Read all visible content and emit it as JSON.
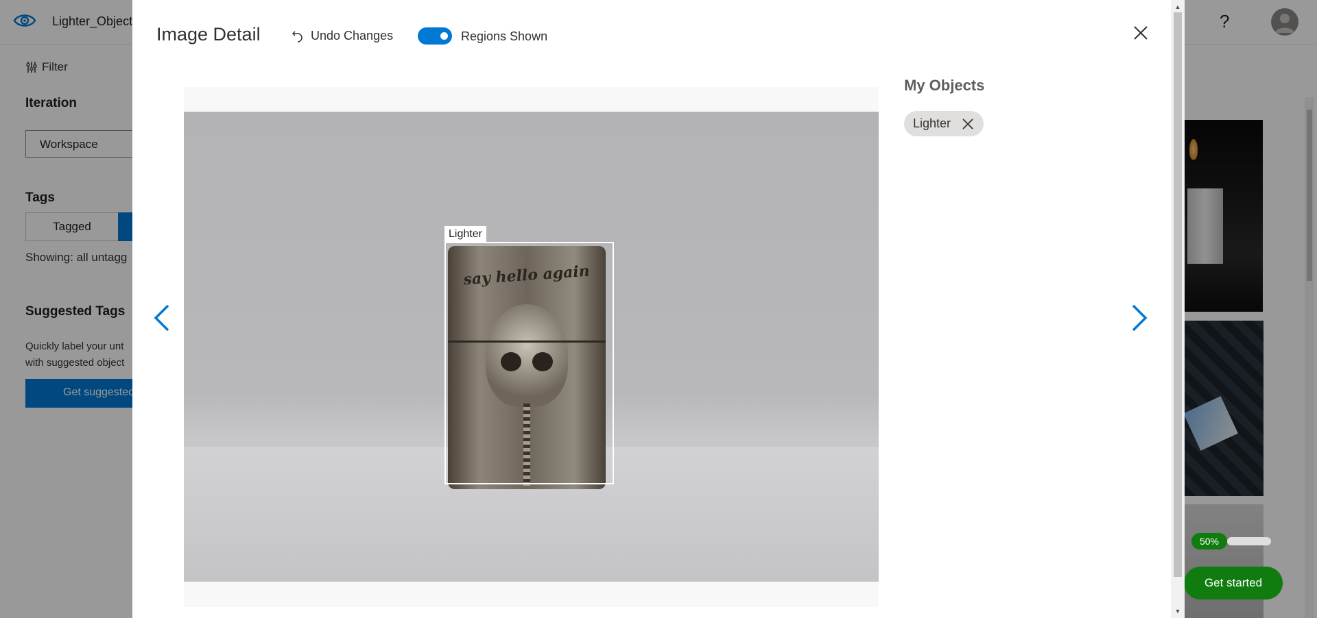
{
  "app": {
    "project_name": "Lighter_Object",
    "settings_icon": "gear-icon",
    "help_label": "?",
    "logo_icon": "eye-icon"
  },
  "sidebar": {
    "filter_label": "Filter",
    "iteration_heading": "Iteration",
    "iteration_value": "Workspace",
    "tags_heading": "Tags",
    "tagged_label": "Tagged",
    "showing_text": "Showing: all untagg",
    "suggested_heading": "Suggested Tags",
    "suggested_desc_line1": "Quickly label your unt",
    "suggested_desc_line2": "with suggested object",
    "get_suggested_label": "Get suggested"
  },
  "onboarding": {
    "progress_label": "50%",
    "progress_value": 0.5,
    "get_started_label": "Get started"
  },
  "modal": {
    "title": "Image Detail",
    "undo_label": "Undo Changes",
    "regions_toggle_label": "Regions Shown",
    "regions_toggle_on": true,
    "region": {
      "label": "Lighter"
    },
    "lighter_engraving": "say hello again",
    "my_objects_heading": "My Objects",
    "objects": [
      {
        "label": "Lighter"
      }
    ]
  },
  "colors": {
    "accent": "#0078d4",
    "success": "#107c10"
  }
}
